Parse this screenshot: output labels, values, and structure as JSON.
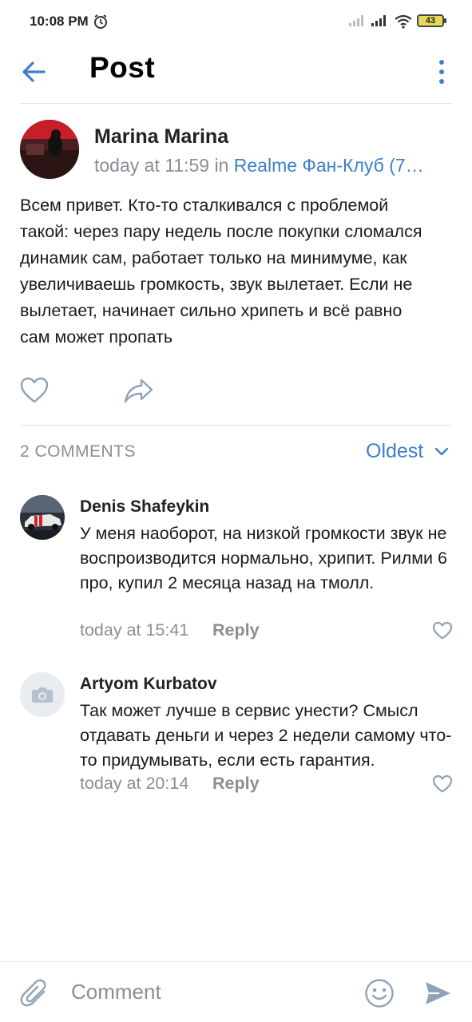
{
  "status_bar": {
    "time": "10:08 PM",
    "battery": "43",
    "icons": [
      "alarm-icon",
      "signal-icon",
      "signal-icon",
      "wifi-icon",
      "battery-icon"
    ]
  },
  "header": {
    "title": "Post",
    "back_icon": "arrow-left-icon",
    "more_icon": "more-vertical-icon"
  },
  "post": {
    "author": "Marina Marina",
    "meta_prefix": "today at 11:59 in ",
    "club": "Realme Фан-Клуб (7…",
    "text": "Всем привет. Кто-то сталкивался с проблемой такой: через пару недель после покупки сломался динамик сам, работает только на минимуме, как увеличиваешь громкость, звук вылетает. Если не вылетает, начинает сильно хрипеть и всё равно сам может пропать"
  },
  "comments_section": {
    "count_label": "2 COMMENTS",
    "sort_label": "Oldest",
    "items": [
      {
        "author": "Denis Shafeykin",
        "text": "У меня наоборот, на низкой громкости звук не воспроизводится нормально, хрипит. Рилми 6 про, купил 2 месяца назад на тмолл.",
        "time": "today at 15:41",
        "reply_label": "Reply"
      },
      {
        "author": "Artyom Kurbatov",
        "text": "Так может лучше в сервис унести? Смысл отдавать деньги и через 2 недели самому что-то придумывать, если есть гарантия.",
        "time": "today at 20:14",
        "reply_label": "Reply"
      }
    ]
  },
  "composer": {
    "placeholder": "Comment"
  },
  "colors": {
    "accent": "#3f7fc9",
    "secondary_text": "#8a8e95",
    "divider": "#e4e6ea"
  }
}
